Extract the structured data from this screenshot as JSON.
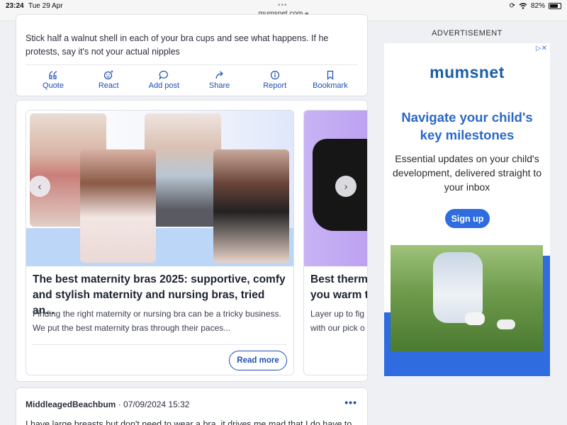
{
  "statusbar": {
    "time": "23:24",
    "date": "Tue 29 Apr",
    "url": "mumsnet.com",
    "battery": "82%",
    "battery_level": 0.82
  },
  "post1": {
    "text": "Stick half a walnut shell in each of your bra cups and see what happens. If he protests, say it's not your actual nipples",
    "actions": [
      {
        "label": "Quote",
        "icon": "quote-icon"
      },
      {
        "label": "React",
        "icon": "react-icon"
      },
      {
        "label": "Add post",
        "icon": "comment-icon"
      },
      {
        "label": "Share",
        "icon": "share-icon"
      },
      {
        "label": "Report",
        "icon": "info-icon"
      },
      {
        "label": "Bookmark",
        "icon": "bookmark-icon"
      }
    ]
  },
  "carousel": {
    "slides": [
      {
        "title": "The best maternity bras 2025: supportive, comfy and stylish maternity and nursing bras, tried an...",
        "description": "Finding the right maternity or nursing bra can be a tricky business. We put the best maternity bras through their paces...",
        "button": "Read more"
      },
      {
        "title": "Best therm you warm t",
        "description": "Layer up to fig with our pick o"
      }
    ],
    "prev_icon": "chevron-left-icon",
    "next_icon": "chevron-right-icon"
  },
  "post2": {
    "username": "MiddleagedBeachbum",
    "timestamp": "· 07/09/2024 15:32",
    "more": "•••",
    "text": "I have large breasts but don't need to wear a bra, it drives me mad that I do have to"
  },
  "ad": {
    "label": "ADVERTISEMENT",
    "adchoices": "▷✕",
    "logo": "mumsnet",
    "headline": "Navigate your child's key milestones",
    "body": "Essential updates on your child's development, delivered straight  to your inbox",
    "button": "Sign up",
    "colors": {
      "brand": "#1a5da8",
      "accent": "#2e6ce0"
    }
  }
}
